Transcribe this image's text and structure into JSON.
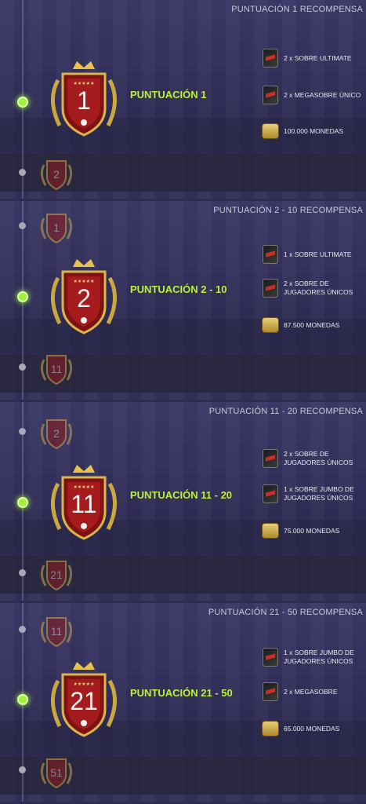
{
  "panels": [
    {
      "title": "PUNTUACIÓN 1 RECOMPENSA",
      "label": "PUNTUACIÓN 1",
      "badge_prev": "",
      "badge_main": "1",
      "badge_next": "2",
      "rewards": [
        {
          "icon": "pack-icon",
          "text": "2 x SOBRE ULTIMATE"
        },
        {
          "icon": "pack-icon",
          "text": "2 x MEGASOBRE ÚNICO"
        },
        {
          "icon": "coins-icon",
          "text": "100.000 MONEDAS"
        }
      ]
    },
    {
      "title": "PUNTUACIÓN 2 - 10 RECOMPENSA",
      "label": "PUNTUACIÓN 2 - 10",
      "badge_prev": "1",
      "badge_main": "2",
      "badge_next": "11",
      "rewards": [
        {
          "icon": "pack-icon",
          "text": "1 x SOBRE ULTIMATE"
        },
        {
          "icon": "pack-icon",
          "text": "2 x SOBRE DE JUGADORES ÚNICOS"
        },
        {
          "icon": "coins-icon",
          "text": "87.500 MONEDAS"
        }
      ]
    },
    {
      "title": "PUNTUACIÓN 11 - 20 RECOMPENSA",
      "label": "PUNTUACIÓN 11 - 20",
      "badge_prev": "2",
      "badge_main": "11",
      "badge_next": "21",
      "rewards": [
        {
          "icon": "pack-icon",
          "text": "2 x SOBRE DE JUGADORES ÚNICOS"
        },
        {
          "icon": "pack-icon",
          "text": "1 x SOBRE JUMBO DE JUGADORES ÚNICOS"
        },
        {
          "icon": "coins-icon",
          "text": "75.000 MONEDAS"
        }
      ]
    },
    {
      "title": "PUNTUACIÓN 21 - 50 RECOMPENSA",
      "label": "PUNTUACIÓN 21 - 50",
      "badge_prev": "11",
      "badge_main": "21",
      "badge_next": "51",
      "rewards": [
        {
          "icon": "pack-icon",
          "text": "1 x SOBRE JUMBO DE JUGADORES ÚNICOS"
        },
        {
          "icon": "pack-icon",
          "text": "2 x MEGASOBRE"
        },
        {
          "icon": "coins-icon",
          "text": "65.000 MONEDAS"
        }
      ]
    }
  ]
}
